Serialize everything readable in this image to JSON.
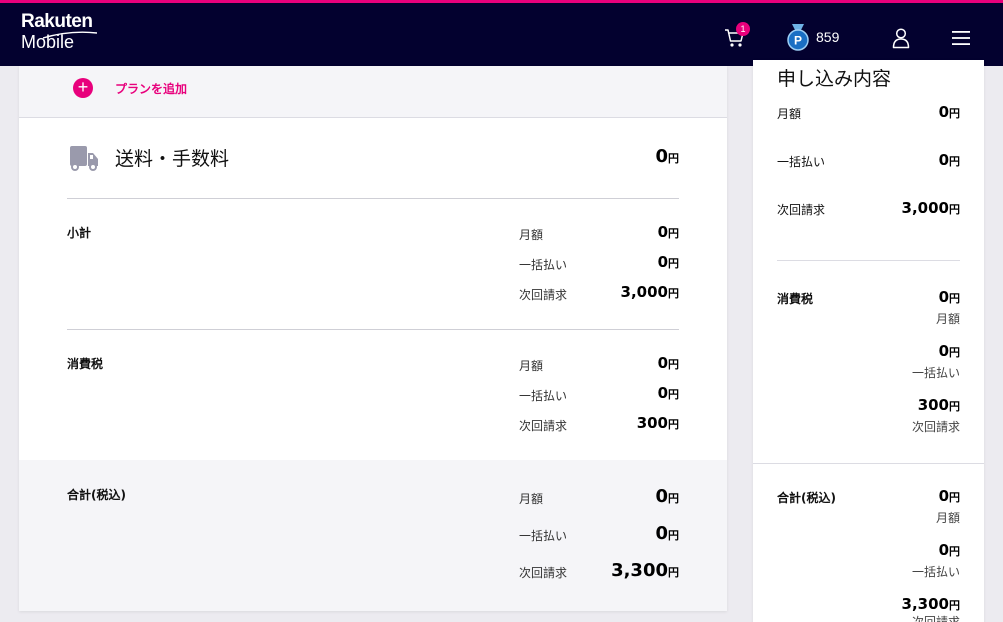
{
  "header": {
    "logo_line1": "Rakuten",
    "logo_line2": "Mobile",
    "cart_count": "1",
    "points": "859",
    "colors": {
      "bar": "#03012f",
      "accent": "#e8007c"
    },
    "icons": [
      "cart-icon",
      "points-medal-icon",
      "user-icon",
      "menu-icon"
    ]
  },
  "main": {
    "add_plan_label": "プランを追加",
    "shipping": {
      "label": "送料・手数料",
      "value": "0",
      "unit": "円"
    },
    "subtotal": {
      "label": "小計",
      "rows": [
        {
          "label": "月額",
          "value": "0",
          "unit": "円"
        },
        {
          "label": "一括払い",
          "value": "0",
          "unit": "円"
        },
        {
          "label": "次回請求",
          "value": "3,000",
          "unit": "円"
        }
      ]
    },
    "tax": {
      "label": "消費税",
      "rows": [
        {
          "label": "月額",
          "value": "0",
          "unit": "円"
        },
        {
          "label": "一括払い",
          "value": "0",
          "unit": "円"
        },
        {
          "label": "次回請求",
          "value": "300",
          "unit": "円"
        }
      ]
    },
    "total": {
      "label": "合計(税込)",
      "rows": [
        {
          "label": "月額",
          "value": "0",
          "unit": "円"
        },
        {
          "label": "一括払い",
          "value": "0",
          "unit": "円"
        },
        {
          "label": "次回請求",
          "value": "3,300",
          "unit": "円"
        }
      ]
    }
  },
  "summary": {
    "title": "申し込み内容",
    "rows": [
      {
        "label": "月額",
        "value": "0",
        "unit": "円"
      },
      {
        "label": "一括払い",
        "value": "0",
        "unit": "円"
      },
      {
        "label": "次回請求",
        "value": "3,000",
        "unit": "円"
      }
    ],
    "tax": {
      "label": "消費税",
      "items": [
        {
          "value": "0",
          "unit": "円",
          "caption": "月額"
        },
        {
          "value": "0",
          "unit": "円",
          "caption": "一括払い"
        },
        {
          "value": "300",
          "unit": "円",
          "caption": "次回請求"
        }
      ]
    },
    "total": {
      "label": "合計(税込)",
      "items": [
        {
          "value": "0",
          "unit": "円",
          "caption": "月額"
        },
        {
          "value": "0",
          "unit": "円",
          "caption": "一括払い"
        },
        {
          "value": "3,300",
          "unit": "円",
          "caption": "次回請求"
        }
      ]
    }
  }
}
